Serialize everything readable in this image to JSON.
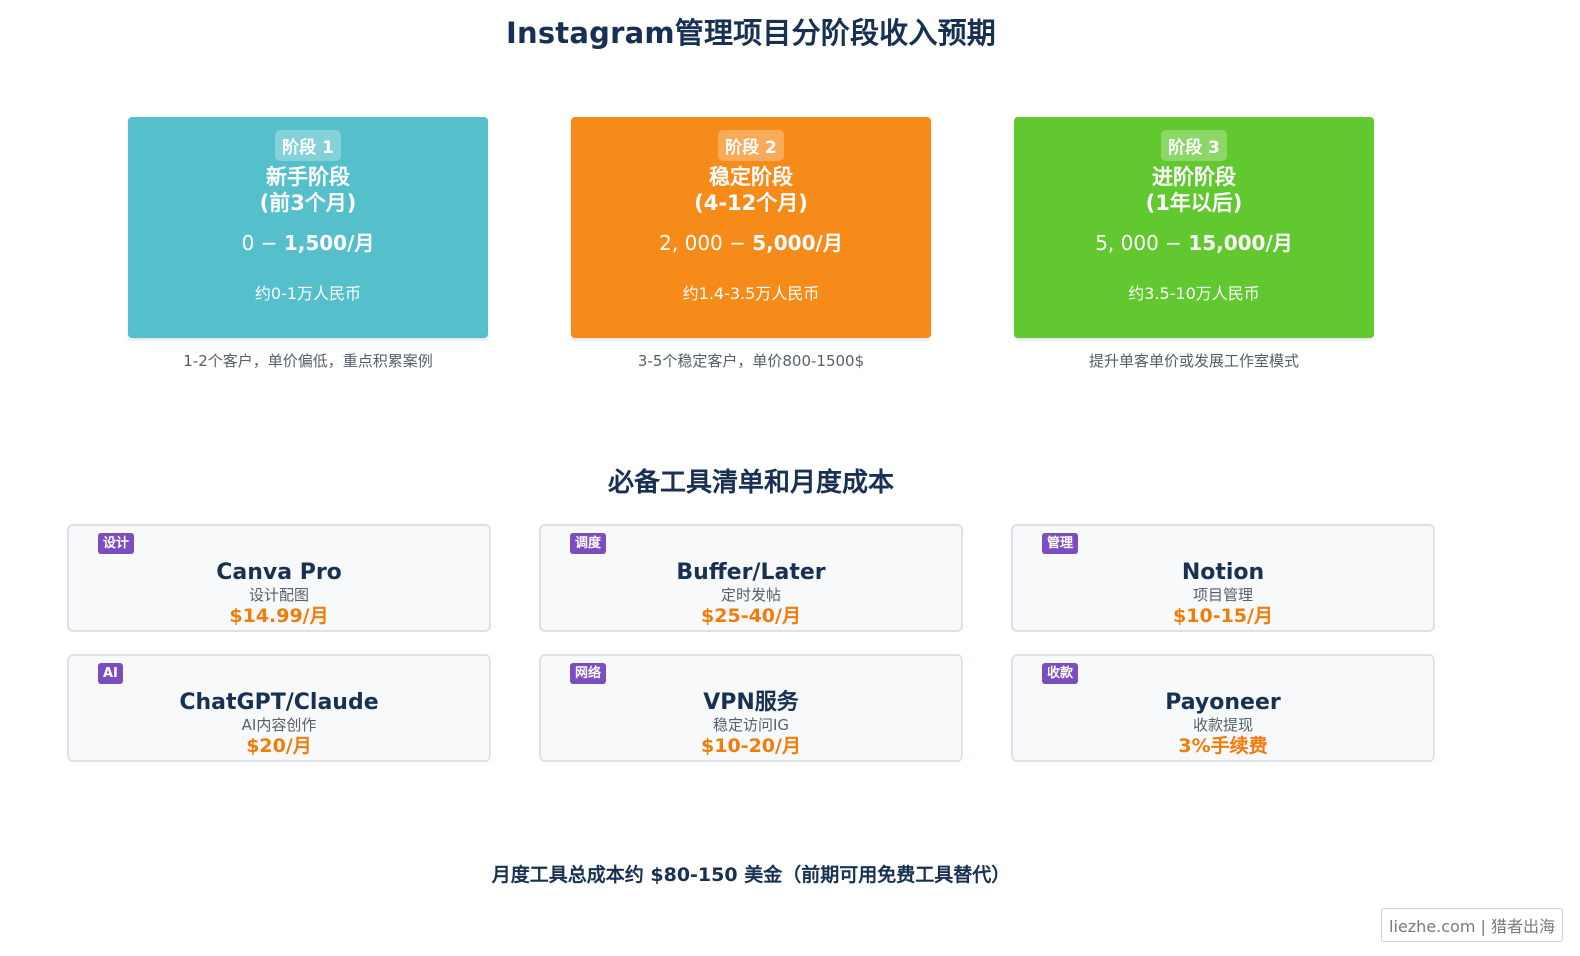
{
  "title": "Instagram管理项目分阶段收入预期",
  "stages": [
    {
      "badge": "阶段 1",
      "name": "新手阶段",
      "period": "(前3个月)",
      "income_low": "0 − ",
      "income_high": "1,500/月",
      "rmb": "约0-1万人民币",
      "note": "1-2个客户，单价偏低，重点积累案例",
      "color": "#56bfcc"
    },
    {
      "badge": "阶段 2",
      "name": "稳定阶段",
      "period": "(4-12个月)",
      "income_low": "2, 000 − ",
      "income_high": "5,000/月",
      "rmb": "约1.4-3.5万人民币",
      "note": "3-5个稳定客户，单价800-1500$",
      "color": "#f78b1a"
    },
    {
      "badge": "阶段 3",
      "name": "进阶阶段",
      "period": "(1年以后)",
      "income_low": "5, 000 − ",
      "income_high": "15,000/月",
      "rmb": "约3.5-10万人民币",
      "note": "提升单客单价或发展工作室模式",
      "color": "#61c830"
    }
  ],
  "tools_title": "必备工具清单和月度成本",
  "tools": [
    {
      "tag": "设计",
      "name": "Canva Pro",
      "desc": "设计配图",
      "price": "$14.99/月"
    },
    {
      "tag": "调度",
      "name": "Buffer/Later",
      "desc": "定时发帖",
      "price": "$25-40/月"
    },
    {
      "tag": "管理",
      "name": "Notion",
      "desc": "项目管理",
      "price": "$10-15/月"
    },
    {
      "tag": "AI",
      "name": "ChatGPT/Claude",
      "desc": "AI内容创作",
      "price": "$20/月"
    },
    {
      "tag": "网络",
      "name": "VPN服务",
      "desc": "稳定访问IG",
      "price": "$10-20/月"
    },
    {
      "tag": "收款",
      "name": "Payoneer",
      "desc": "收款提现",
      "price": "3%手续费"
    }
  ],
  "footer": "月度工具总成本约 $80-150 美金（前期可用免费工具替代）",
  "watermark": "liezhe.com | 猎者出海"
}
